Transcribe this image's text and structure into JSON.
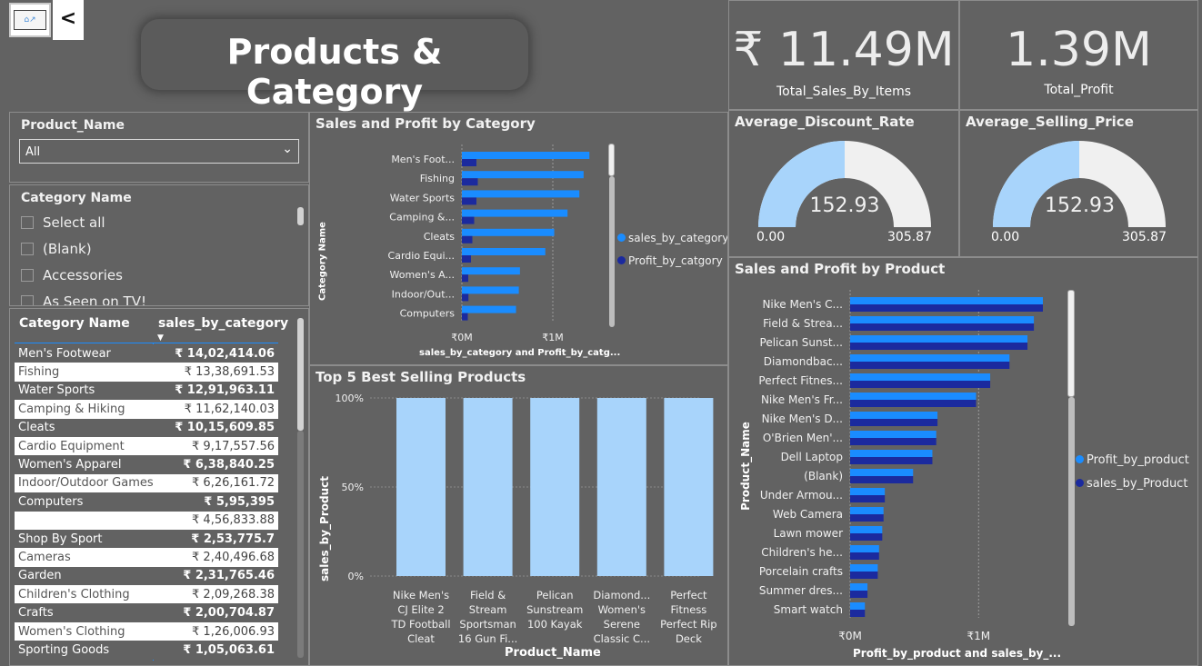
{
  "nav": {
    "home_label": "⌂↗",
    "back_label": "<"
  },
  "page": {
    "title": "Products & Category"
  },
  "cards": {
    "total_sales": {
      "value": "₹ 11.49M",
      "label": "Total_Sales_By_Items"
    },
    "total_profit": {
      "value": "1.39M",
      "label": "Total_Profit"
    }
  },
  "gauges": {
    "discount": {
      "title": "Average_Discount_Rate",
      "value": "152.93",
      "min": "0.00",
      "max": "305.87",
      "fraction": 0.5
    },
    "price": {
      "title": "Average_Selling_Price",
      "value": "152.93",
      "min": "0.00",
      "max": "305.87",
      "fraction": 0.5
    }
  },
  "slicers": {
    "product": {
      "title": "Product_Name",
      "selected": "All"
    },
    "category": {
      "title": "Category Name",
      "items": [
        "Select all",
        "(Blank)",
        "Accessories",
        "As Seen on TV!"
      ]
    }
  },
  "table": {
    "headers": [
      "Category Name",
      "sales_by_category"
    ],
    "rows": [
      [
        "Men's Footwear",
        "₹ 14,02,414.06"
      ],
      [
        "Fishing",
        "₹ 13,38,691.53"
      ],
      [
        "Water Sports",
        "₹ 12,91,963.11"
      ],
      [
        "Camping & Hiking",
        "₹ 11,62,140.03"
      ],
      [
        "Cleats",
        "₹ 10,15,609.85"
      ],
      [
        "Cardio Equipment",
        "₹ 9,17,557.56"
      ],
      [
        "Women's Apparel",
        "₹ 6,38,840.25"
      ],
      [
        "Indoor/Outdoor Games",
        "₹ 6,26,161.72"
      ],
      [
        "Computers",
        "₹ 5,95,395"
      ],
      [
        "",
        "₹ 4,56,833.88"
      ],
      [
        "Shop By Sport",
        "₹ 2,53,775.7"
      ],
      [
        "Cameras",
        "₹ 2,40,496.68"
      ],
      [
        "Garden",
        "₹ 2,31,765.46"
      ],
      [
        "Children's Clothing",
        "₹ 2,09,268.38"
      ],
      [
        "Crafts",
        "₹ 2,00,704.87"
      ],
      [
        "Women's Clothing",
        "₹ 1,26,006.93"
      ],
      [
        "Sporting Goods",
        "₹ 1,05,063.61"
      ]
    ]
  },
  "colors": {
    "sales": "#1a8cff",
    "profit": "#1b2a9e",
    "bar_light": "#a8d4fb",
    "gauge_fill": "#a8d4fb",
    "gauge_bg": "#f0f0f0"
  },
  "chart_data": [
    {
      "type": "bar",
      "title": "Sales and Profit by Category",
      "orientation": "horizontal",
      "ylabel": "Category Name",
      "xlabel": "sales_by_category and Profit_by_catg...",
      "categories": [
        "Men's Foot...",
        "Fishing",
        "Water Sports",
        "Camping &...",
        "Cleats",
        "Cardio Equi...",
        "Women's A...",
        "Indoor/Out...",
        "Computers"
      ],
      "series": [
        {
          "name": "sales_by_category",
          "values": [
            1402414,
            1338692,
            1291963,
            1162140,
            1015610,
            917558,
            638840,
            626162,
            595395
          ]
        },
        {
          "name": "Profit_by_catgory",
          "values": [
            160000,
            175000,
            160000,
            135000,
            115000,
            100000,
            70000,
            72000,
            65000
          ]
        }
      ],
      "xticks": [
        "₹0M",
        "₹1M"
      ],
      "xlim": [
        0,
        1400000
      ],
      "legend": "right"
    },
    {
      "type": "bar",
      "title": "Top 5 Best Selling Products",
      "xlabel": "Product_Name",
      "ylabel": "sales_by_Product",
      "categories": [
        [
          "Nike Men's",
          "CJ Elite 2",
          "TD Football",
          "Cleat"
        ],
        [
          "Field &",
          "Stream",
          "Sportsman",
          "16 Gun Fi..."
        ],
        [
          "Pelican",
          "Sunstream",
          "100 Kayak"
        ],
        [
          "Diamond...",
          "Women's",
          "Serene",
          "Classic C..."
        ],
        [
          "Perfect",
          "Fitness",
          "Perfect Rip",
          "Deck"
        ]
      ],
      "values": [
        100,
        100,
        100,
        100,
        100
      ],
      "yticks": [
        "100%",
        "50%",
        "0%"
      ],
      "ylim": [
        0,
        100
      ]
    },
    {
      "type": "bar",
      "title": "Sales and Profit by Product",
      "orientation": "horizontal",
      "ylabel": "Product_Name",
      "xlabel": "Profit_by_product and sales_by_...",
      "categories": [
        "Nike Men's C...",
        "Field & Strea...",
        "Pelican Sunst...",
        "Diamondbac...",
        "Perfect Fitnes...",
        "Nike Men's Fr...",
        "Nike Men's D...",
        "O'Brien Men'...",
        "Dell Laptop",
        "(Blank)",
        "Under Armou...",
        "Web Camera",
        "Lawn mower",
        "Children's he...",
        "Porcelain crafts",
        "Summer dres...",
        "Smart watch"
      ],
      "series": [
        {
          "name": "Profit_by_product",
          "values": [
            1500000,
            1430000,
            1380000,
            1240000,
            1090000,
            980000,
            680000,
            670000,
            640000,
            490000,
            270000,
            260000,
            250000,
            225000,
            215000,
            135000,
            115000
          ]
        },
        {
          "name": "sales_by_Product",
          "values": [
            1500000,
            1430000,
            1380000,
            1240000,
            1090000,
            980000,
            680000,
            670000,
            640000,
            490000,
            270000,
            260000,
            250000,
            225000,
            215000,
            135000,
            115000
          ]
        }
      ],
      "xticks": [
        "₹0M",
        "₹1M"
      ],
      "xlim": [
        0,
        1500000
      ],
      "legend": "right"
    }
  ]
}
